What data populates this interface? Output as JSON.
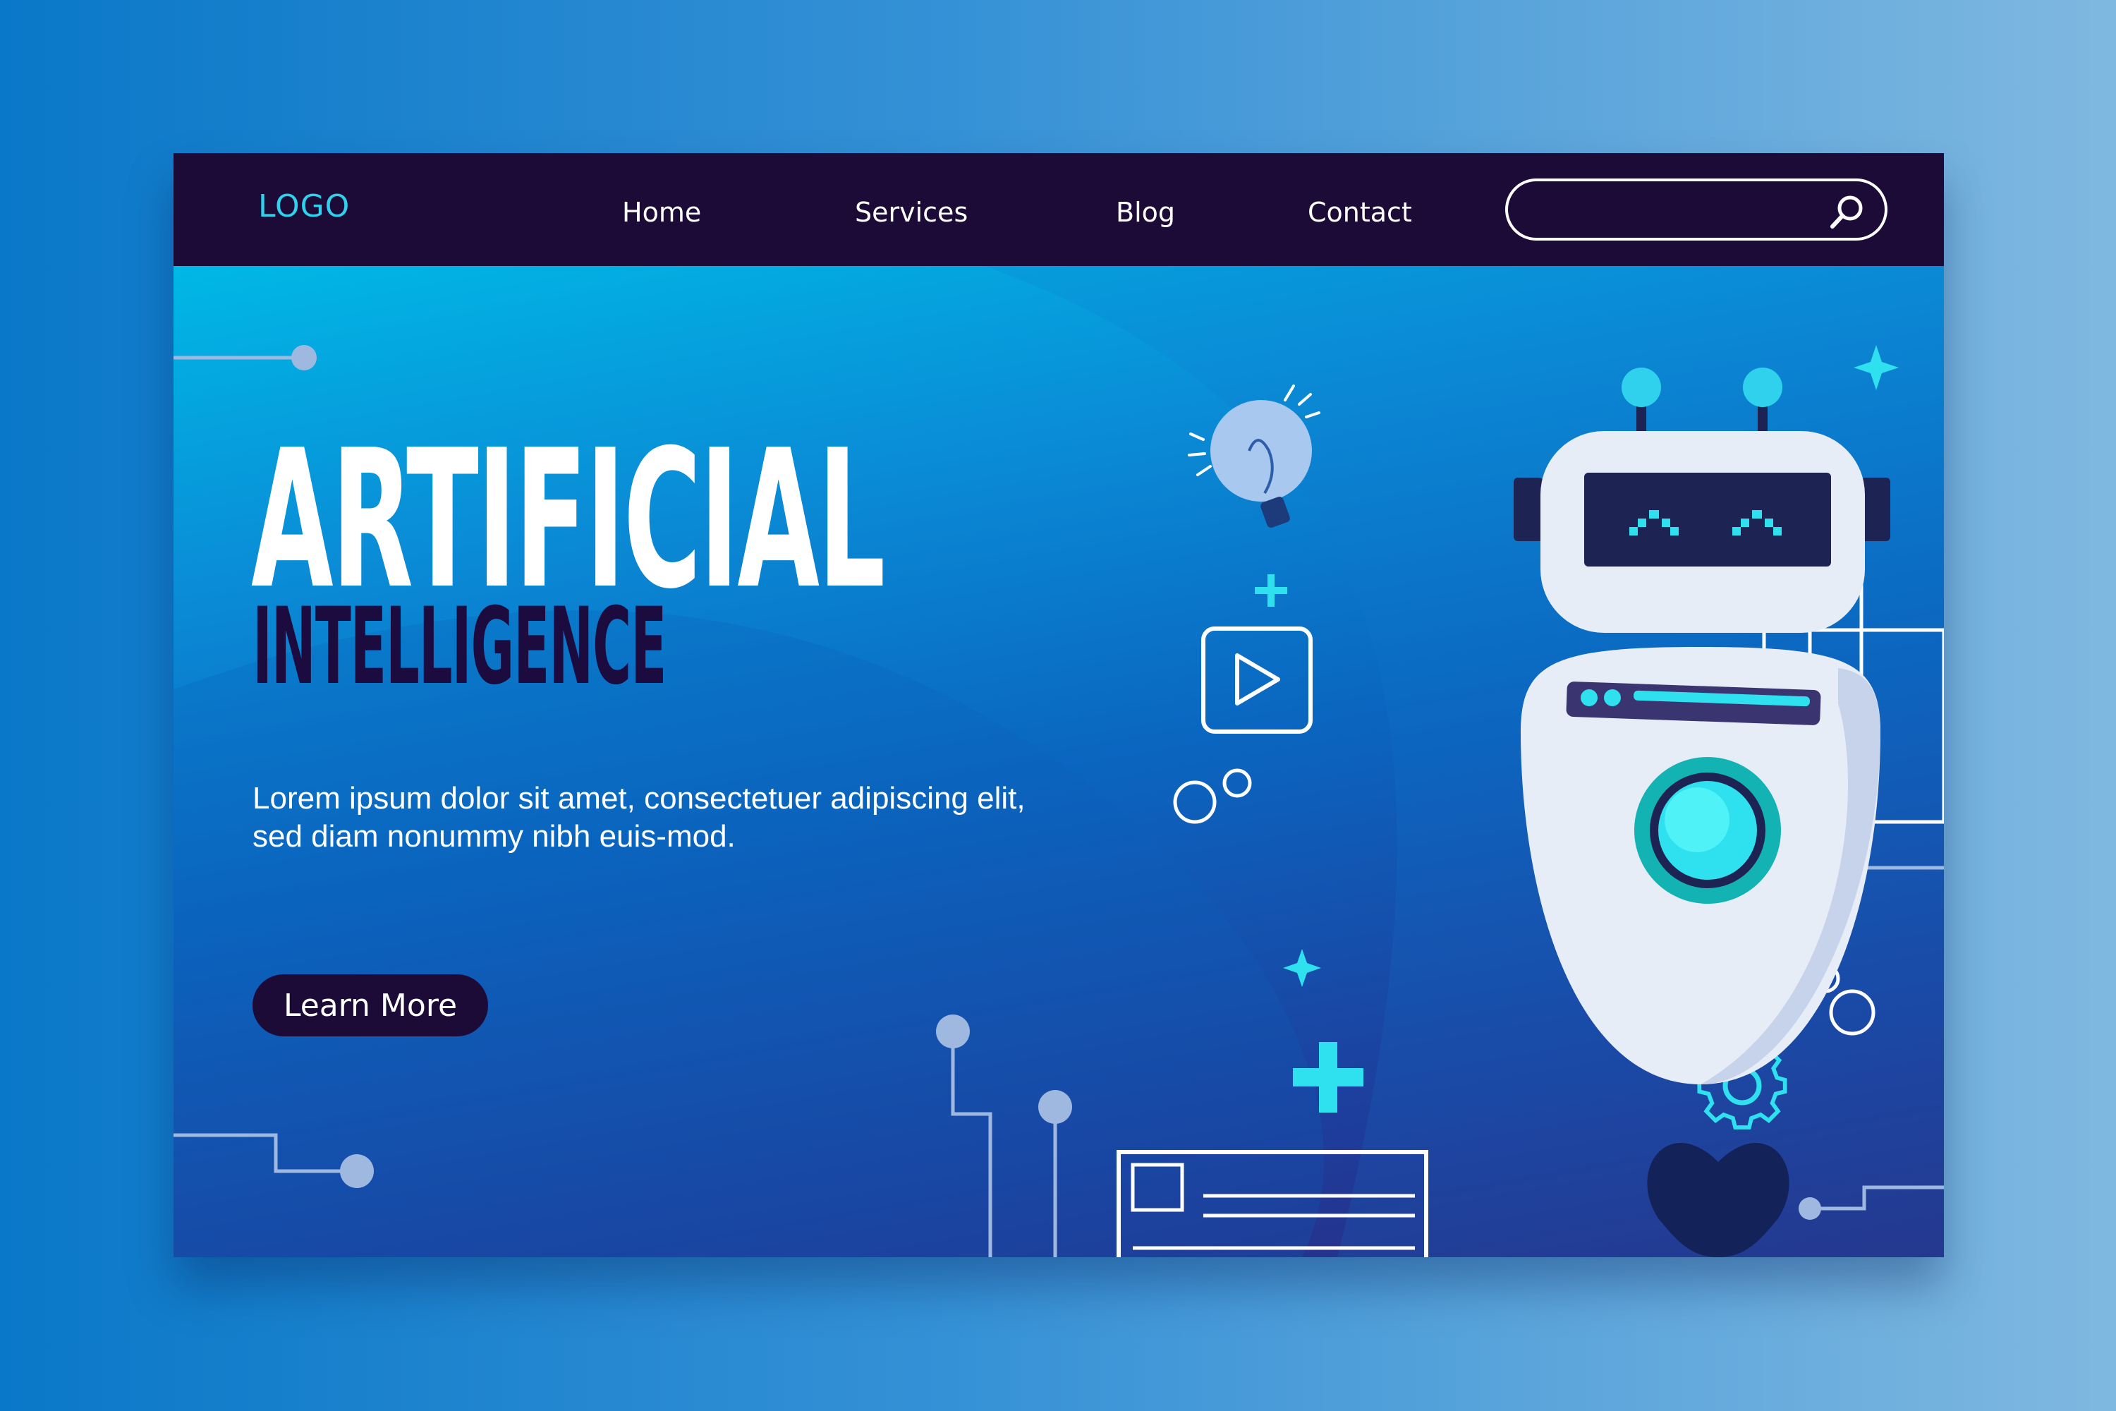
{
  "nav": {
    "logo": "LOGO",
    "links": [
      "Home",
      "Services",
      "Blog",
      "Contact"
    ],
    "search_placeholder": ""
  },
  "hero": {
    "title": "ARTIFICIAL",
    "subtitle": "INTELLIGENCE",
    "description": "Lorem ipsum dolor sit amet, consectetuer adipiscing elit, sed diam nonummy nibh euis-mod.",
    "cta_label": "Learn More"
  },
  "icons": {
    "search": "search-icon",
    "robot": "robot-icon",
    "lightbulb": "lightbulb-icon",
    "play": "play-icon",
    "gear": "gear-icon"
  },
  "colors": {
    "nav_bg": "#1d0b37",
    "accent": "#2fd1ec",
    "title": "#ffffff",
    "subtitle": "#1b0b3f"
  }
}
